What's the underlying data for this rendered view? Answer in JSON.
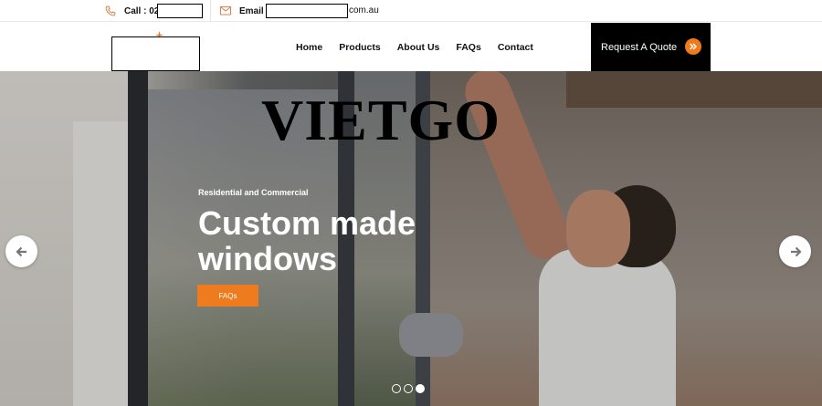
{
  "topbar": {
    "call_label": "Call : 02",
    "email_label": "Email :",
    "email_suffix": "com.au",
    "phone_icon": "phone-icon",
    "email_icon": "envelope-icon"
  },
  "header": {
    "nav": [
      "Home",
      "Products",
      "About Us",
      "FAQs",
      "Contact"
    ],
    "quote_label": "Request A Quote",
    "quote_icon": "double-chevron-right-icon"
  },
  "hero": {
    "brand": "VIETGO",
    "eyebrow": "Residential and Commercial",
    "headline": "Custom made windows",
    "cta_label": "FAQs",
    "prev_icon": "arrow-left-icon",
    "next_icon": "arrow-right-icon",
    "slides_total": 3,
    "active_slide": 3
  },
  "colors": {
    "accent": "#ef7b1f",
    "dark": "#000000",
    "text": "#111111"
  }
}
